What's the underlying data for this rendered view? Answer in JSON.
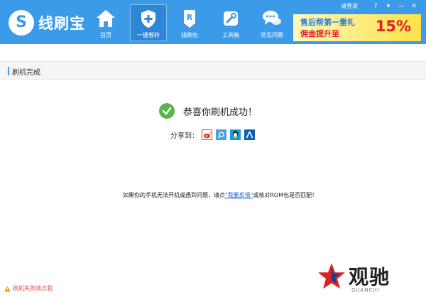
{
  "app": {
    "logo_letter": "S",
    "title": "线刷宝"
  },
  "top_right": {
    "login": "请登录",
    "help": "?",
    "minimize": "▾",
    "menu": "—",
    "close": "✕"
  },
  "nav": [
    {
      "label": "首页",
      "icon": "home-icon"
    },
    {
      "label": "一键救砖",
      "icon": "shield-plus-icon",
      "active": true
    },
    {
      "label": "线刷包",
      "icon": "rom-package-icon"
    },
    {
      "label": "工具箱",
      "icon": "wrench-icon"
    },
    {
      "label": "常见问题",
      "icon": "chat-bubbles-icon"
    }
  ],
  "banner": {
    "line1": "售后帮第一重礼",
    "line2": "佣金提升至",
    "percent": "15%"
  },
  "section": {
    "title": "刷机完成"
  },
  "success": {
    "message": "恭喜你刷机成功！"
  },
  "share": {
    "label": "分享到：",
    "icons": [
      "weibo-icon",
      "tencent-weibo-icon",
      "qq-icon",
      "renren-icon"
    ]
  },
  "hint": {
    "before": "如果你的手机无法开机或遇到问题，请点",
    "link": "\"我要反馈\"",
    "after": "或核对ROM包是否匹配！"
  },
  "footer": {
    "link": "刷机失败请点我"
  },
  "watermark": {
    "text": "观驰",
    "sub": "GUANCHI"
  },
  "colors": {
    "header": "#3b9be8",
    "success": "#5bb448",
    "link": "#1f5fd6",
    "warning": "#d9534f"
  }
}
